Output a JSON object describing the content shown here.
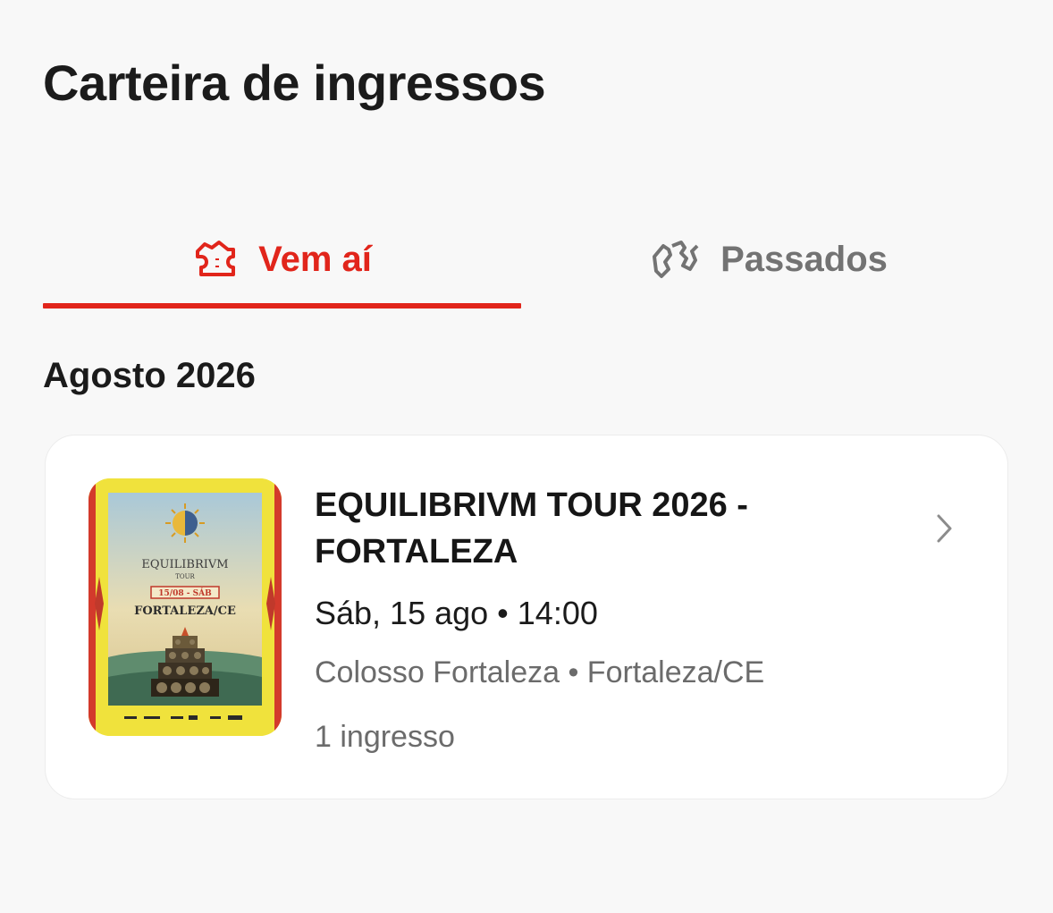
{
  "header": {
    "title": "Carteira de ingressos"
  },
  "tabs": [
    {
      "label": "Vem aí",
      "icon": "ticket-icon",
      "active": true
    },
    {
      "label": "Passados",
      "icon": "past-tickets-icon",
      "active": false
    }
  ],
  "colors": {
    "accent": "#e1251b",
    "inactive": "#737373",
    "background": "#f8f8f8",
    "card": "#ffffff"
  },
  "section": {
    "heading": "Agosto 2026"
  },
  "event": {
    "title_line1": "EQUILIBRIVM TOUR 2026 -",
    "title_line2": "FORTALEZA",
    "datetime": "Sáb, 15 ago • 14:00",
    "venue": "Colosso Fortaleza • Fortaleza/CE",
    "tickets": "1 ingresso",
    "poster": {
      "title": "EQUILIBRIVM",
      "subtitle": "TOUR",
      "date_badge": "15/08 - SÁB",
      "city": "FORTALEZA/CE"
    }
  }
}
